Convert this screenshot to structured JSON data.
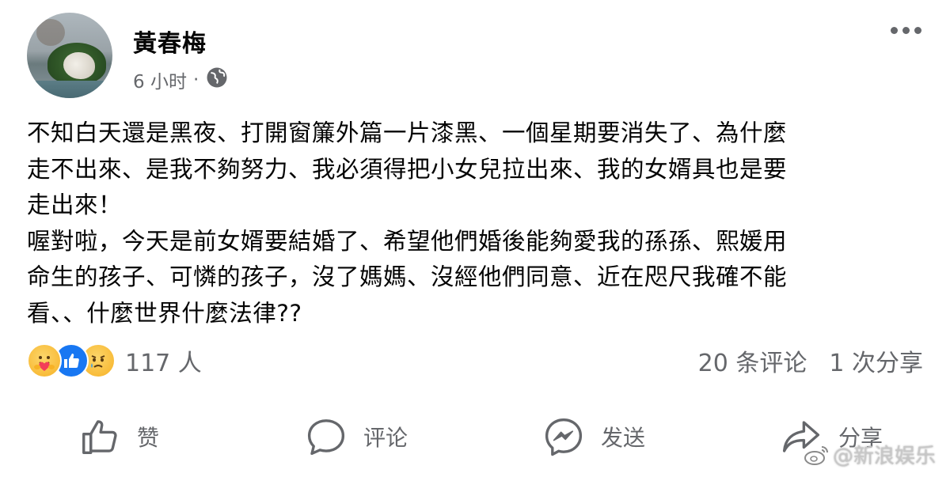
{
  "post": {
    "author": "黃春梅",
    "time": "6 小时",
    "separator": "·",
    "privacy_icon": "globe-icon",
    "more_icon": "more-icon",
    "text": "不知白天還是黑夜、打開窗簾外篇一片漆黑、一個星期要消失了、為什麼\n走不出來、是我不夠努力、我必須得把小女兒拉出來、我的女婿具也是要\n走出來！\n喔對啦，今天是前女婿要結婚了、希望他們婚後能夠愛我的孫孫、熙媛用\n命生的孩子、可憐的孩子，沒了媽媽、沒經他們同意、近在咫尺我確不能\n看、、什麼世界什麼法律??"
  },
  "stats": {
    "reaction_icons": [
      "care-icon",
      "like-icon",
      "sad-icon"
    ],
    "reaction_count": "117 人",
    "comments": "20 条评论",
    "shares": "1 次分享"
  },
  "actions": {
    "like": "赞",
    "comment": "评论",
    "send": "发送",
    "share": "分享"
  },
  "watermark": {
    "text": "@新浪娱乐",
    "icon": "weibo-icon"
  },
  "colors": {
    "text": "#050505",
    "secondary": "#65676b",
    "like_blue": "#1877f2",
    "reaction_yellow": "#f7b125"
  }
}
